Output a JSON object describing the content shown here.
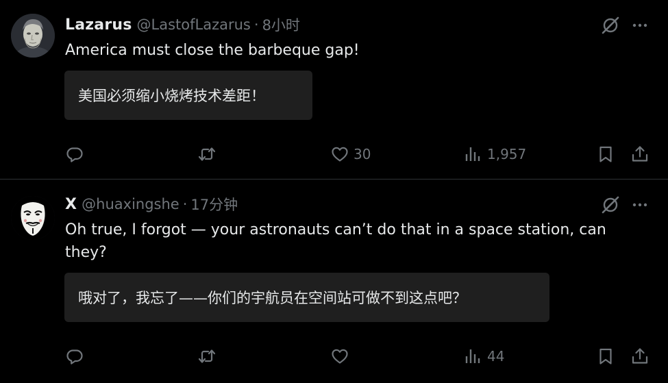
{
  "tweets": [
    {
      "name": "Lazarus",
      "handle": "@LastofLazarus",
      "separator": "·",
      "time": "8小时",
      "text": "America must close the barbeque gap!",
      "translation": "美国必须缩小烧烤技术差距！",
      "stats": {
        "likes": "30",
        "views": "1,957"
      },
      "avatar_icon": "portrait-avatar"
    },
    {
      "name": "X",
      "handle": "@huaxingshe",
      "separator": "·",
      "time": "17分钟",
      "text": "Oh true, I forgot — your astronauts can’t do that in a space station, can they?",
      "translation": "哦对了，我忘了——你们的宇航员在空间站可做不到这点吧？",
      "stats": {
        "likes": "",
        "views": "44"
      },
      "avatar_icon": "guy-fawkes-mask-avatar"
    }
  ],
  "icons": {
    "grok": "grok-icon",
    "more": "more-icon",
    "reply": "reply-icon",
    "retweet": "retweet-icon",
    "like": "heart-icon",
    "views": "views-icon",
    "bookmark": "bookmark-icon",
    "share": "share-icon"
  },
  "colors": {
    "background": "#000000",
    "text": "#e7e9ea",
    "secondary": "#71767b",
    "translation_bg": "#1f1f1f",
    "divider": "#2f3336"
  }
}
